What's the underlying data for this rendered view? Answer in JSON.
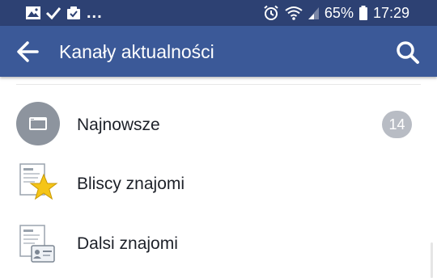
{
  "status_bar": {
    "notification_icons": [
      "image-icon",
      "check-icon",
      "check-clipboard-icon"
    ],
    "overflow": "...",
    "system_icons": [
      "alarm-icon",
      "wifi-icon",
      "signal-icon"
    ],
    "battery_percent": "65%",
    "time": "17:29"
  },
  "app_bar": {
    "title": "Kanały aktualności",
    "background": "#3b5998"
  },
  "feeds": [
    {
      "label": "Najnowsze",
      "icon": "recent-feed-icon",
      "badge": "14"
    },
    {
      "label": "Bliscy znajomi",
      "icon": "close-friends-star-icon"
    },
    {
      "label": "Dalsi znajomi",
      "icon": "acquaintances-id-card-icon"
    }
  ]
}
